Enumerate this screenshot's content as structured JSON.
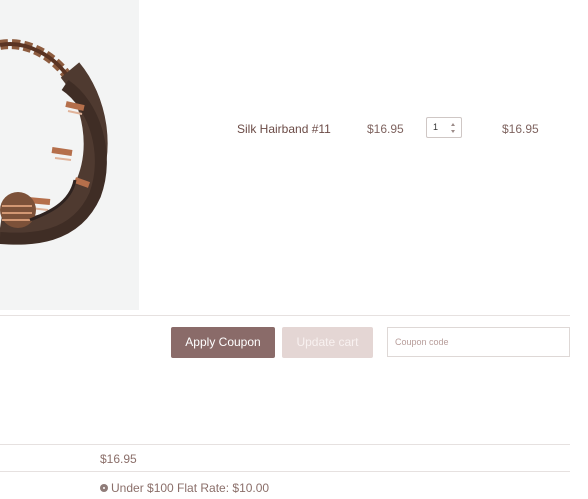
{
  "cart_item": {
    "name": "Silk Hairband #11",
    "price": "$16.95",
    "quantity": "1",
    "subtotal": "$16.95"
  },
  "actions": {
    "apply_coupon_label": "Apply Coupon",
    "update_cart_label": "Update cart",
    "coupon_placeholder": "Coupon code"
  },
  "totals": {
    "subtotal": "$16.95",
    "shipping_option": "Under $100 Flat Rate: $10.00"
  },
  "colors": {
    "accent": "#8a6b69",
    "disabled_button": "#e4d6d4",
    "text": "#7f6460"
  }
}
